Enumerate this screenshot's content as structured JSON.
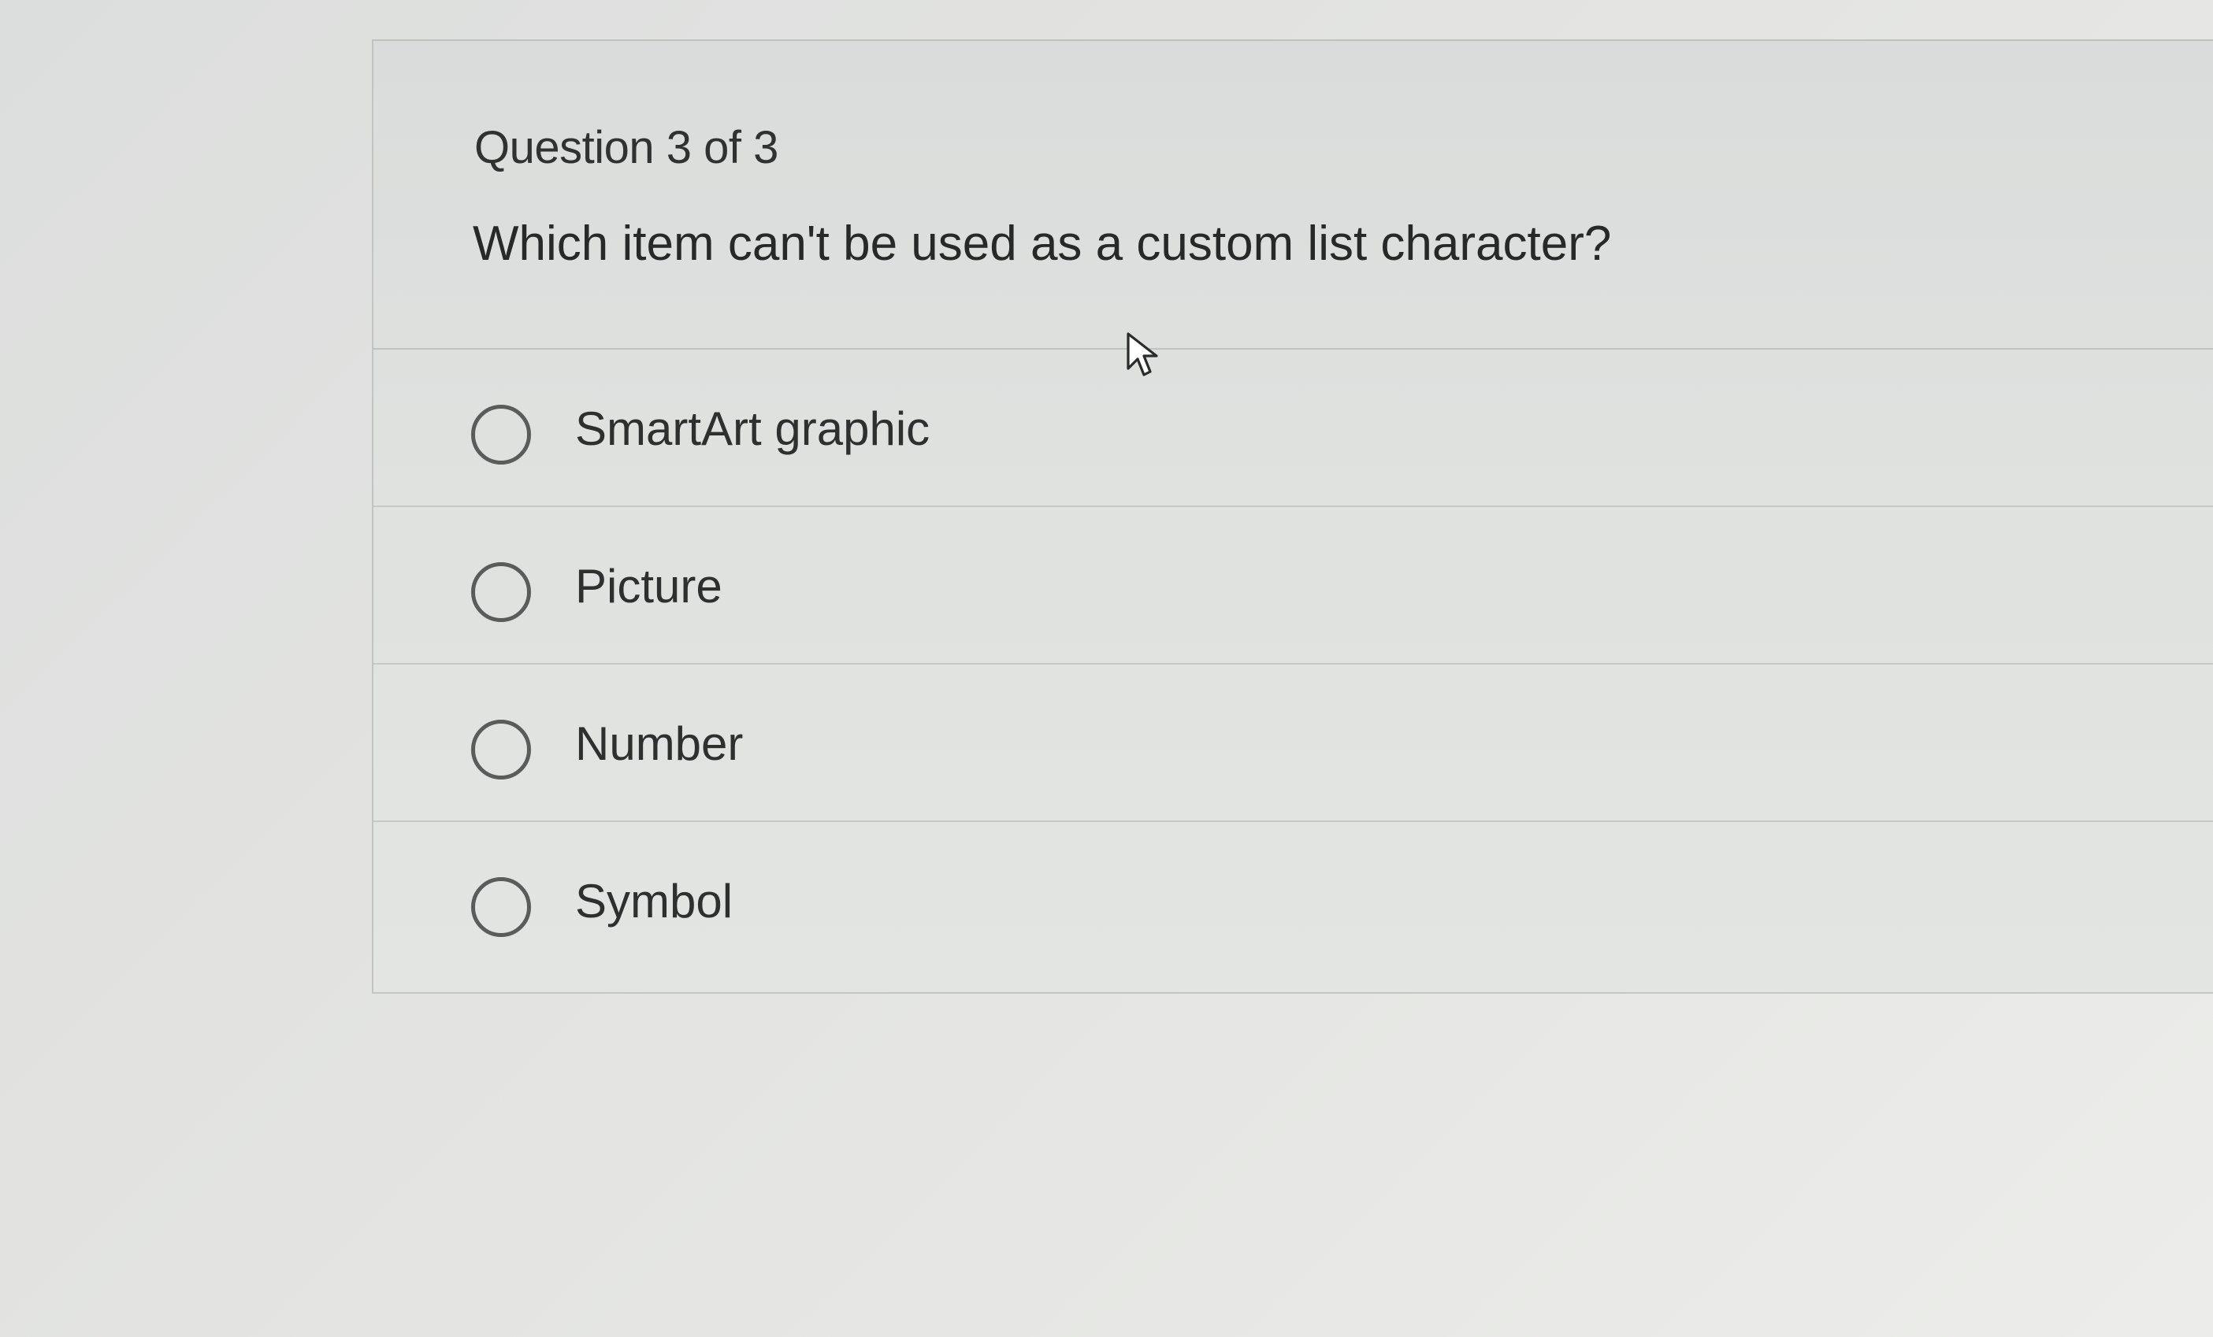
{
  "question": {
    "counter": "Question 3 of 3",
    "text": "Which item can't be used as a custom list character?"
  },
  "options": [
    {
      "label": "SmartArt graphic",
      "selected": false
    },
    {
      "label": "Picture",
      "selected": false
    },
    {
      "label": "Number",
      "selected": false
    },
    {
      "label": "Symbol",
      "selected": false
    }
  ],
  "pointer": {
    "icon": "arrow-cursor-icon"
  }
}
